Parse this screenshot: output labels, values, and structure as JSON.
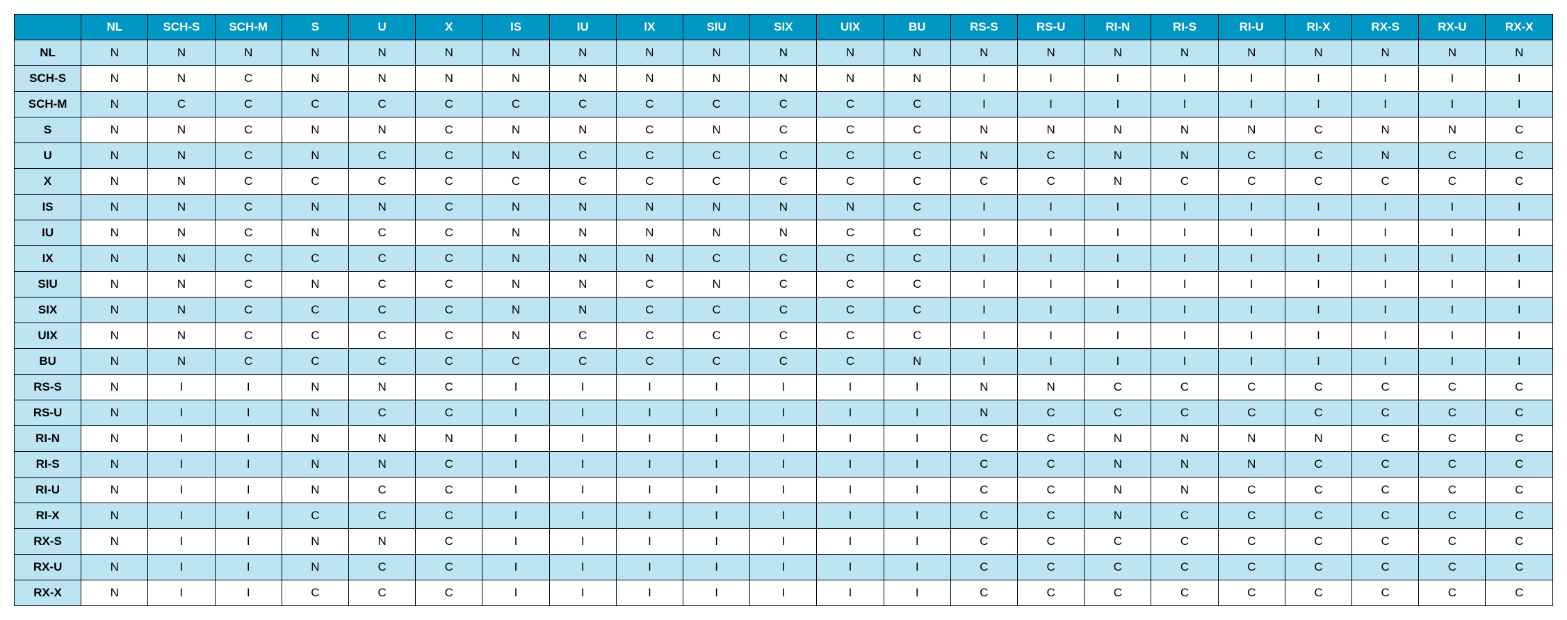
{
  "chart_data": {
    "type": "table",
    "columns": [
      "NL",
      "SCH-S",
      "SCH-M",
      "S",
      "U",
      "X",
      "IS",
      "IU",
      "IX",
      "SIU",
      "SIX",
      "UIX",
      "BU",
      "RS-S",
      "RS-U",
      "RI-N",
      "RI-S",
      "RI-U",
      "RI-X",
      "RX-S",
      "RX-U",
      "RX-X"
    ],
    "rows": [
      "NL",
      "SCH-S",
      "SCH-M",
      "S",
      "U",
      "X",
      "IS",
      "IU",
      "IX",
      "SIU",
      "SIX",
      "UIX",
      "BU",
      "RS-S",
      "RS-U",
      "RI-N",
      "RI-S",
      "RI-U",
      "RI-X",
      "RX-S",
      "RX-U",
      "RX-X"
    ],
    "cells": [
      [
        "N",
        "N",
        "N",
        "N",
        "N",
        "N",
        "N",
        "N",
        "N",
        "N",
        "N",
        "N",
        "N",
        "N",
        "N",
        "N",
        "N",
        "N",
        "N",
        "N",
        "N",
        "N"
      ],
      [
        "N",
        "N",
        "C",
        "N",
        "N",
        "N",
        "N",
        "N",
        "N",
        "N",
        "N",
        "N",
        "N",
        "I",
        "I",
        "I",
        "I",
        "I",
        "I",
        "I",
        "I",
        "I"
      ],
      [
        "N",
        "C",
        "C",
        "C",
        "C",
        "C",
        "C",
        "C",
        "C",
        "C",
        "C",
        "C",
        "C",
        "I",
        "I",
        "I",
        "I",
        "I",
        "I",
        "I",
        "I",
        "I"
      ],
      [
        "N",
        "N",
        "C",
        "N",
        "N",
        "C",
        "N",
        "N",
        "C",
        "N",
        "C",
        "C",
        "C",
        "N",
        "N",
        "N",
        "N",
        "N",
        "C",
        "N",
        "N",
        "C"
      ],
      [
        "N",
        "N",
        "C",
        "N",
        "C",
        "C",
        "N",
        "C",
        "C",
        "C",
        "C",
        "C",
        "C",
        "N",
        "C",
        "N",
        "N",
        "C",
        "C",
        "N",
        "C",
        "C"
      ],
      [
        "N",
        "N",
        "C",
        "C",
        "C",
        "C",
        "C",
        "C",
        "C",
        "C",
        "C",
        "C",
        "C",
        "C",
        "C",
        "N",
        "C",
        "C",
        "C",
        "C",
        "C",
        "C"
      ],
      [
        "N",
        "N",
        "C",
        "N",
        "N",
        "C",
        "N",
        "N",
        "N",
        "N",
        "N",
        "N",
        "C",
        "I",
        "I",
        "I",
        "I",
        "I",
        "I",
        "I",
        "I",
        "I"
      ],
      [
        "N",
        "N",
        "C",
        "N",
        "C",
        "C",
        "N",
        "N",
        "N",
        "N",
        "N",
        "C",
        "C",
        "I",
        "I",
        "I",
        "I",
        "I",
        "I",
        "I",
        "I",
        "I"
      ],
      [
        "N",
        "N",
        "C",
        "C",
        "C",
        "C",
        "N",
        "N",
        "N",
        "C",
        "C",
        "C",
        "C",
        "I",
        "I",
        "I",
        "I",
        "I",
        "I",
        "I",
        "I",
        "I"
      ],
      [
        "N",
        "N",
        "C",
        "N",
        "C",
        "C",
        "N",
        "N",
        "C",
        "N",
        "C",
        "C",
        "C",
        "I",
        "I",
        "I",
        "I",
        "I",
        "I",
        "I",
        "I",
        "I"
      ],
      [
        "N",
        "N",
        "C",
        "C",
        "C",
        "C",
        "N",
        "N",
        "C",
        "C",
        "C",
        "C",
        "C",
        "I",
        "I",
        "I",
        "I",
        "I",
        "I",
        "I",
        "I",
        "I"
      ],
      [
        "N",
        "N",
        "C",
        "C",
        "C",
        "C",
        "N",
        "C",
        "C",
        "C",
        "C",
        "C",
        "C",
        "I",
        "I",
        "I",
        "I",
        "I",
        "I",
        "I",
        "I",
        "I"
      ],
      [
        "N",
        "N",
        "C",
        "C",
        "C",
        "C",
        "C",
        "C",
        "C",
        "C",
        "C",
        "C",
        "N",
        "I",
        "I",
        "I",
        "I",
        "I",
        "I",
        "I",
        "I",
        "I"
      ],
      [
        "N",
        "I",
        "I",
        "N",
        "N",
        "C",
        "I",
        "I",
        "I",
        "I",
        "I",
        "I",
        "I",
        "N",
        "N",
        "C",
        "C",
        "C",
        "C",
        "C",
        "C",
        "C"
      ],
      [
        "N",
        "I",
        "I",
        "N",
        "C",
        "C",
        "I",
        "I",
        "I",
        "I",
        "I",
        "I",
        "I",
        "N",
        "C",
        "C",
        "C",
        "C",
        "C",
        "C",
        "C",
        "C"
      ],
      [
        "N",
        "I",
        "I",
        "N",
        "N",
        "N",
        "I",
        "I",
        "I",
        "I",
        "I",
        "I",
        "I",
        "C",
        "C",
        "N",
        "N",
        "N",
        "N",
        "C",
        "C",
        "C"
      ],
      [
        "N",
        "I",
        "I",
        "N",
        "N",
        "C",
        "I",
        "I",
        "I",
        "I",
        "I",
        "I",
        "I",
        "C",
        "C",
        "N",
        "N",
        "N",
        "C",
        "C",
        "C",
        "C"
      ],
      [
        "N",
        "I",
        "I",
        "N",
        "C",
        "C",
        "I",
        "I",
        "I",
        "I",
        "I",
        "I",
        "I",
        "C",
        "C",
        "N",
        "N",
        "C",
        "C",
        "C",
        "C",
        "C"
      ],
      [
        "N",
        "I",
        "I",
        "C",
        "C",
        "C",
        "I",
        "I",
        "I",
        "I",
        "I",
        "I",
        "I",
        "C",
        "C",
        "N",
        "C",
        "C",
        "C",
        "C",
        "C",
        "C"
      ],
      [
        "N",
        "I",
        "I",
        "N",
        "N",
        "C",
        "I",
        "I",
        "I",
        "I",
        "I",
        "I",
        "I",
        "C",
        "C",
        "C",
        "C",
        "C",
        "C",
        "C",
        "C",
        "C"
      ],
      [
        "N",
        "I",
        "I",
        "N",
        "C",
        "C",
        "I",
        "I",
        "I",
        "I",
        "I",
        "I",
        "I",
        "C",
        "C",
        "C",
        "C",
        "C",
        "C",
        "C",
        "C",
        "C"
      ],
      [
        "N",
        "I",
        "I",
        "C",
        "C",
        "C",
        "I",
        "I",
        "I",
        "I",
        "I",
        "I",
        "I",
        "C",
        "C",
        "C",
        "C",
        "C",
        "C",
        "C",
        "C",
        "C"
      ]
    ]
  }
}
